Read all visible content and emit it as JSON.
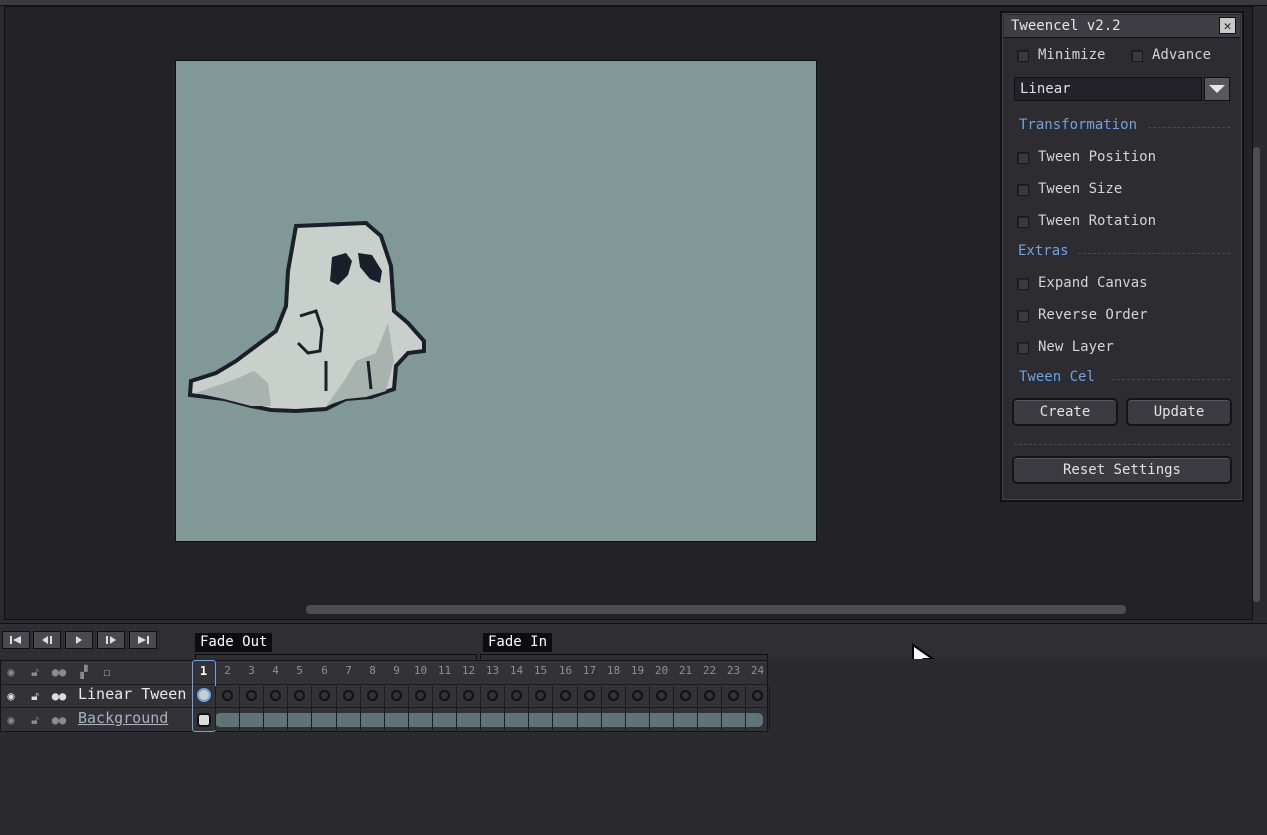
{
  "dialog": {
    "title": "Tweencel v2.2",
    "close_glyph": "✕",
    "minimize_label": "Minimize",
    "advance_label": "Advance",
    "easing_value": "Linear",
    "section_transformation": "Transformation",
    "tween_position_label": "Tween Position",
    "tween_size_label": "Tween Size",
    "tween_rotation_label": "Tween Rotation",
    "section_extras": "Extras",
    "expand_canvas_label": "Expand Canvas",
    "reverse_order_label": "Reverse Order",
    "new_layer_label": "New Layer",
    "section_tween_cel": "Tween Cel",
    "create_label": "Create",
    "update_label": "Update",
    "reset_label": "Reset Settings"
  },
  "timeline": {
    "tags": [
      "Fade Out",
      "Fade In"
    ],
    "layers": [
      "Linear Tween",
      "Background"
    ],
    "frames": [
      "1",
      "2",
      "3",
      "4",
      "5",
      "6",
      "7",
      "8",
      "9",
      "10",
      "11",
      "12",
      "13",
      "14",
      "15",
      "16",
      "17",
      "18",
      "19",
      "20",
      "21",
      "22",
      "23",
      "24"
    ]
  },
  "colors": {
    "accent": "#6aa4e6",
    "canvas_bg": "#809896",
    "ghost_fill": "#c9d0cc",
    "ghost_outline": "#1a2029"
  }
}
